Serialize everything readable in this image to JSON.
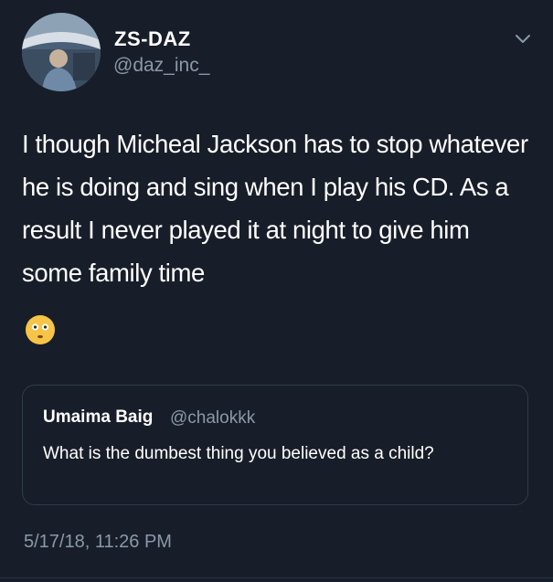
{
  "author": {
    "display_name": "ZS-DAZ",
    "handle": "@daz_inc_",
    "avatar_icon": "profile-photo"
  },
  "tweet": {
    "text": "I though Micheal Jackson has to stop whatever he is doing and sing when I play his CD. As a result I never played it at night to give him some family time",
    "emoji": "flushed-face-emoji",
    "timestamp": "5/17/18, 11:26 PM"
  },
  "quoted_tweet": {
    "display_name": "Umaima Baig",
    "handle": "@chalokkk",
    "text": "What is the dumbest thing you believed as a child?"
  },
  "menu": {
    "icon": "chevron-down-icon"
  },
  "colors": {
    "background": "#171e29",
    "text": "#ffffff",
    "secondary_text": "#8a98a8",
    "border": "#2f3b4a"
  }
}
